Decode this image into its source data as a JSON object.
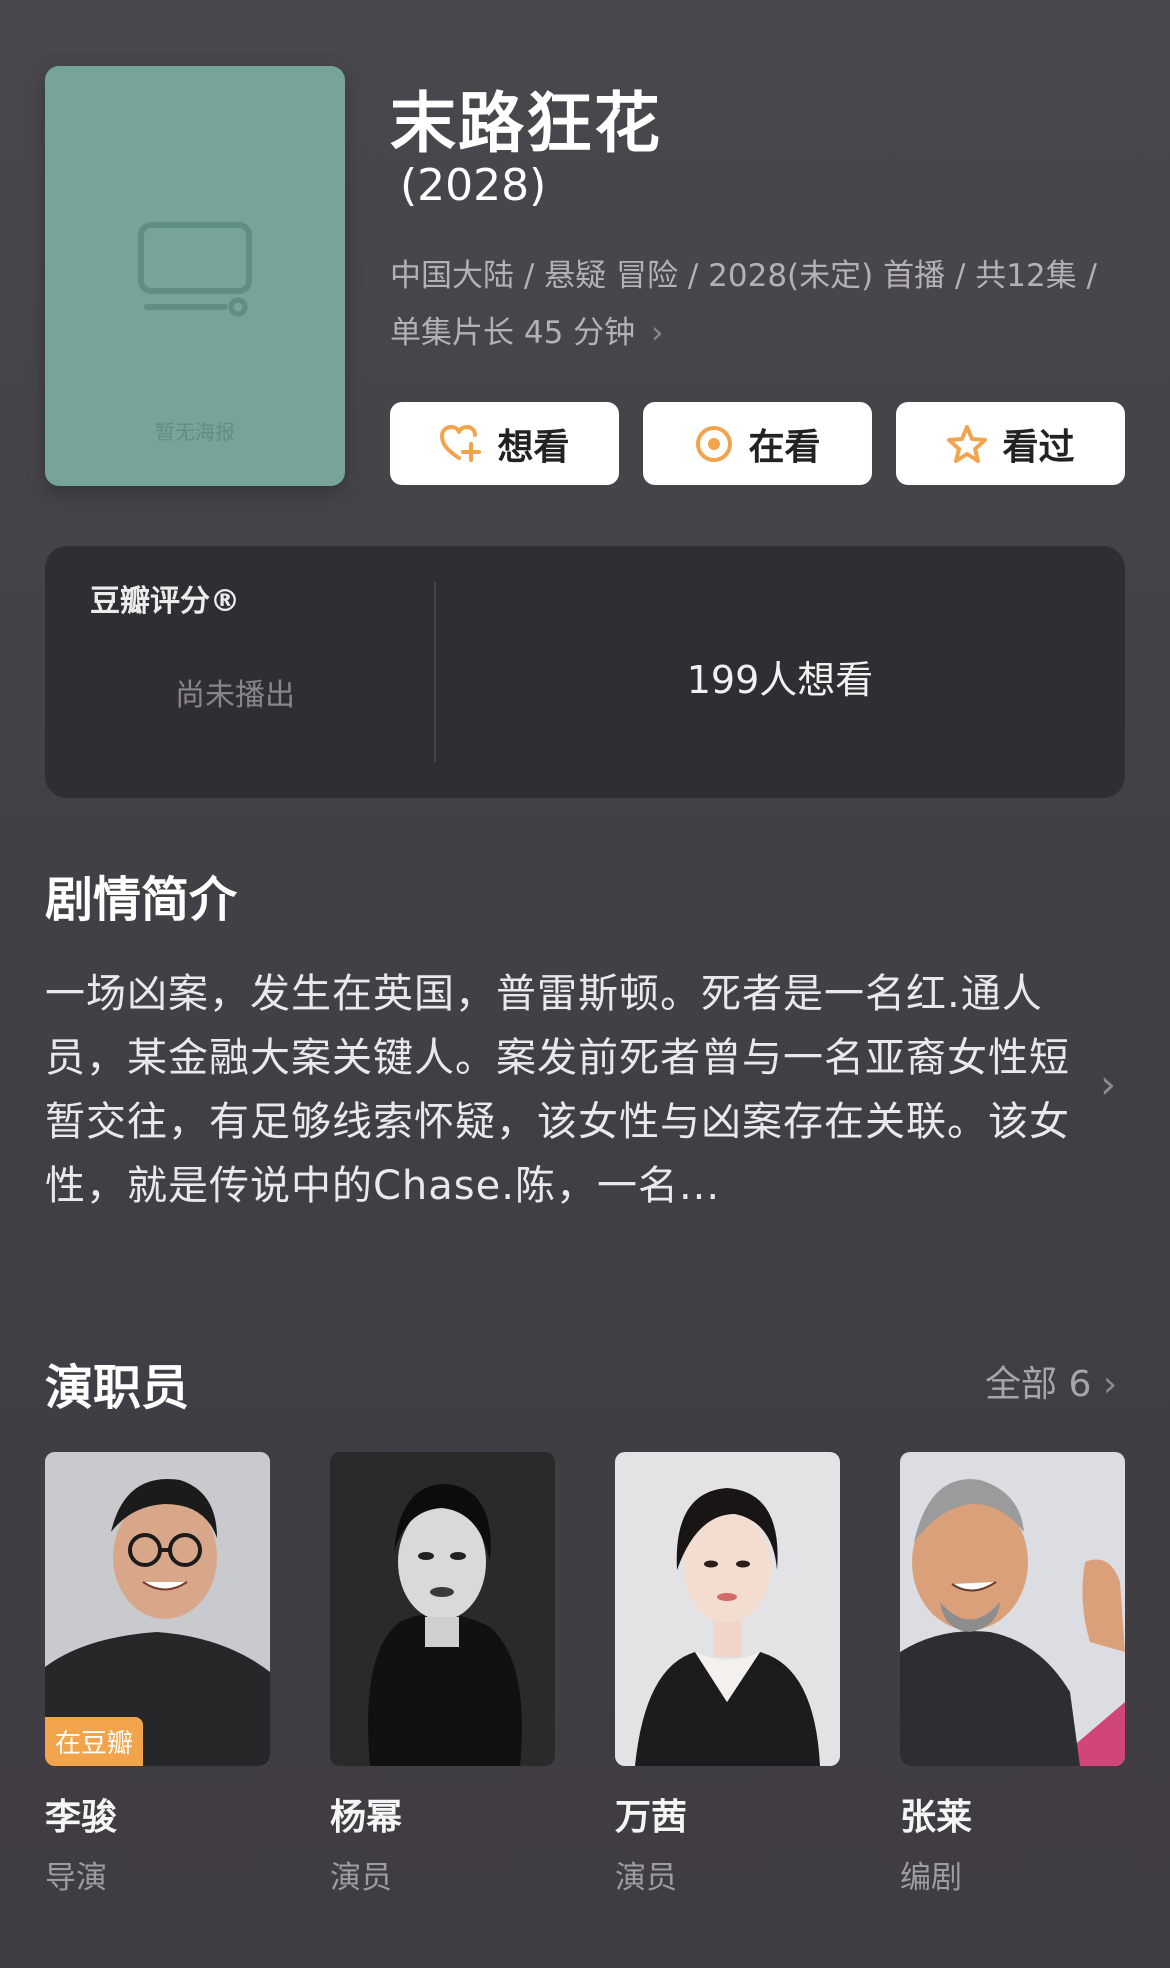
{
  "poster": {
    "placeholder_text": "暂无海报"
  },
  "show": {
    "title": "末路狂花",
    "year": "(2028)",
    "meta_line1": "中国大陆 / 悬疑 冒险 / 2028(未定) 首播 / 共12集 /",
    "meta_line2": "单集片长 45 分钟"
  },
  "actions": {
    "want": "想看",
    "watching": "在看",
    "watched": "看过"
  },
  "rating": {
    "label": "豆瓣评分®",
    "status": "尚未播出",
    "wish_count": "199人想看"
  },
  "synopsis": {
    "title": "剧情简介",
    "text": "一场凶案，发生在英国，普雷斯顿。死者是一名红.通人员，某金融大案关键人。案发前死者曾与一名亚裔女性短暂交往，有足够线索怀疑，该女性与凶案存在关联。该女性，就是传说中的Chase.陈，一名..."
  },
  "cast": {
    "title": "演职员",
    "all_label": "全部 6",
    "members": [
      {
        "name": "李骏",
        "role": "导演",
        "badge": "在豆瓣"
      },
      {
        "name": "杨幂",
        "role": "演员"
      },
      {
        "name": "万茜",
        "role": "演员"
      },
      {
        "name": "张莱",
        "role": "编剧"
      }
    ]
  },
  "colors": {
    "background": "#413e44",
    "poster": "#76a39a",
    "accent": "#f1a44c",
    "card": "#302e33"
  }
}
